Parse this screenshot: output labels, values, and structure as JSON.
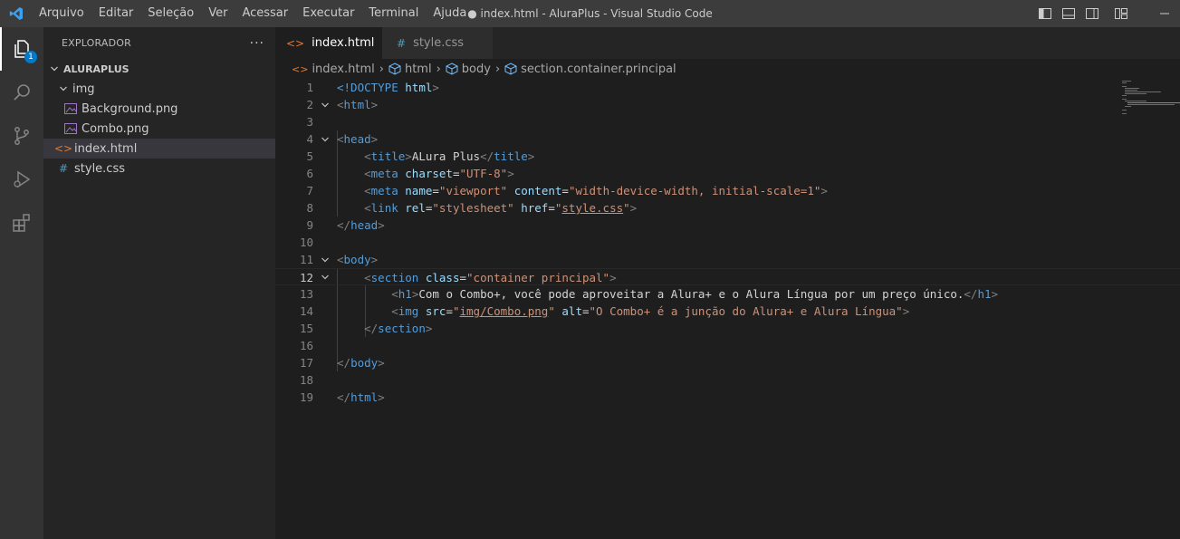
{
  "titlebar": {
    "menu": [
      "Arquivo",
      "Editar",
      "Seleção",
      "Ver",
      "Acessar",
      "Executar",
      "Terminal",
      "Ajuda"
    ],
    "window_title": "● index.html - AluraPlus - Visual Studio Code"
  },
  "activity": {
    "badge_count": "1"
  },
  "sidebar": {
    "title": "EXPLORADOR",
    "more": "···",
    "root": "ALURAPLUS",
    "items": [
      {
        "label": "img",
        "kind": "folder",
        "icon": "chevron-down-icon"
      },
      {
        "label": "Background.png",
        "kind": "image",
        "icon": "image-file-icon"
      },
      {
        "label": "Combo.png",
        "kind": "image",
        "icon": "image-file-icon"
      },
      {
        "label": "index.html",
        "kind": "html",
        "icon": "html-file-icon"
      },
      {
        "label": "style.css",
        "kind": "css",
        "icon": "css-file-icon"
      }
    ]
  },
  "tabs": [
    {
      "label": "index.html",
      "icon": "html-file-icon",
      "active": true,
      "dirty": true
    },
    {
      "label": "style.css",
      "icon": "css-file-icon",
      "active": false,
      "dirty": false
    }
  ],
  "breadcrumb": {
    "file": "index.html",
    "items": [
      "html",
      "body",
      "section.container.principal"
    ]
  },
  "colors": {
    "tag": "#569cd6",
    "attribute": "#9cdcfe",
    "string": "#ce9178",
    "punctuation": "#808080",
    "accent": "#007acc"
  },
  "code": {
    "current_line": "12",
    "lines": [
      {
        "n": "1",
        "fold": false
      },
      {
        "n": "2",
        "fold": true
      },
      {
        "n": "3",
        "fold": false
      },
      {
        "n": "4",
        "fold": true
      },
      {
        "n": "5",
        "fold": false
      },
      {
        "n": "6",
        "fold": false
      },
      {
        "n": "7",
        "fold": false
      },
      {
        "n": "8",
        "fold": false
      },
      {
        "n": "9",
        "fold": false
      },
      {
        "n": "10",
        "fold": false
      },
      {
        "n": "11",
        "fold": true
      },
      {
        "n": "12",
        "fold": true
      },
      {
        "n": "13",
        "fold": false
      },
      {
        "n": "14",
        "fold": false
      },
      {
        "n": "15",
        "fold": false
      },
      {
        "n": "16",
        "fold": false
      },
      {
        "n": "17",
        "fold": false
      },
      {
        "n": "18",
        "fold": false
      },
      {
        "n": "19",
        "fold": false
      }
    ],
    "tokens": {
      "l1a": "<!DOCTYPE ",
      "l1b": "html",
      "l1c": ">",
      "l2a": "<",
      "l2b": "html",
      "l2c": ">",
      "l4a": "<",
      "l4b": "head",
      "l4c": ">",
      "l5a": "<",
      "l5b": "title",
      "l5c": ">",
      "l5d": "ALura Plus",
      "l5e": "</",
      "l5f": "title",
      "l5g": ">",
      "l6a": "<",
      "l6b": "meta",
      "l6c": " charset",
      "l6d": "=",
      "l6e": "\"UTF-8\"",
      "l6f": ">",
      "l7a": "<",
      "l7b": "meta",
      "l7c": " name",
      "l7d": "=",
      "l7e": "\"viewport\"",
      "l7f": " content",
      "l7g": "=",
      "l7h": "\"width-device-width, initial-scale=1\"",
      "l7i": ">",
      "l8a": "<",
      "l8b": "link",
      "l8c": " rel",
      "l8d": "=",
      "l8e": "\"stylesheet\"",
      "l8f": " href",
      "l8g": "=",
      "l8h": "\"",
      "l8i": "style.css",
      "l8j": "\"",
      "l8k": ">",
      "l9a": "</",
      "l9b": "head",
      "l9c": ">",
      "l11a": "<",
      "l11b": "body",
      "l11c": ">",
      "l12a": "<",
      "l12b": "section",
      "l12c": " class",
      "l12d": "=",
      "l12e": "\"container principal\"",
      "l12f": ">",
      "l13a": "<",
      "l13b": "h1",
      "l13c": ">",
      "l13d": "Com o Combo+, você pode aproveitar a Alura+ e o Alura Língua por um preço único.",
      "l13e": "</",
      "l13f": "h1",
      "l13g": ">",
      "l14a": "<",
      "l14b": "img",
      "l14c": " src",
      "l14d": "=",
      "l14e": "\"",
      "l14f": "img/Combo.png",
      "l14g": "\"",
      "l14h": " alt",
      "l14i": "=",
      "l14j": "\"O Combo+ é a junção do Alura+ e Alura Língua\"",
      "l14k": ">",
      "l15a": "</",
      "l15b": "section",
      "l15c": ">",
      "l17a": "</",
      "l17b": "body",
      "l17c": ">",
      "l19a": "</",
      "l19b": "html",
      "l19c": ">"
    }
  }
}
